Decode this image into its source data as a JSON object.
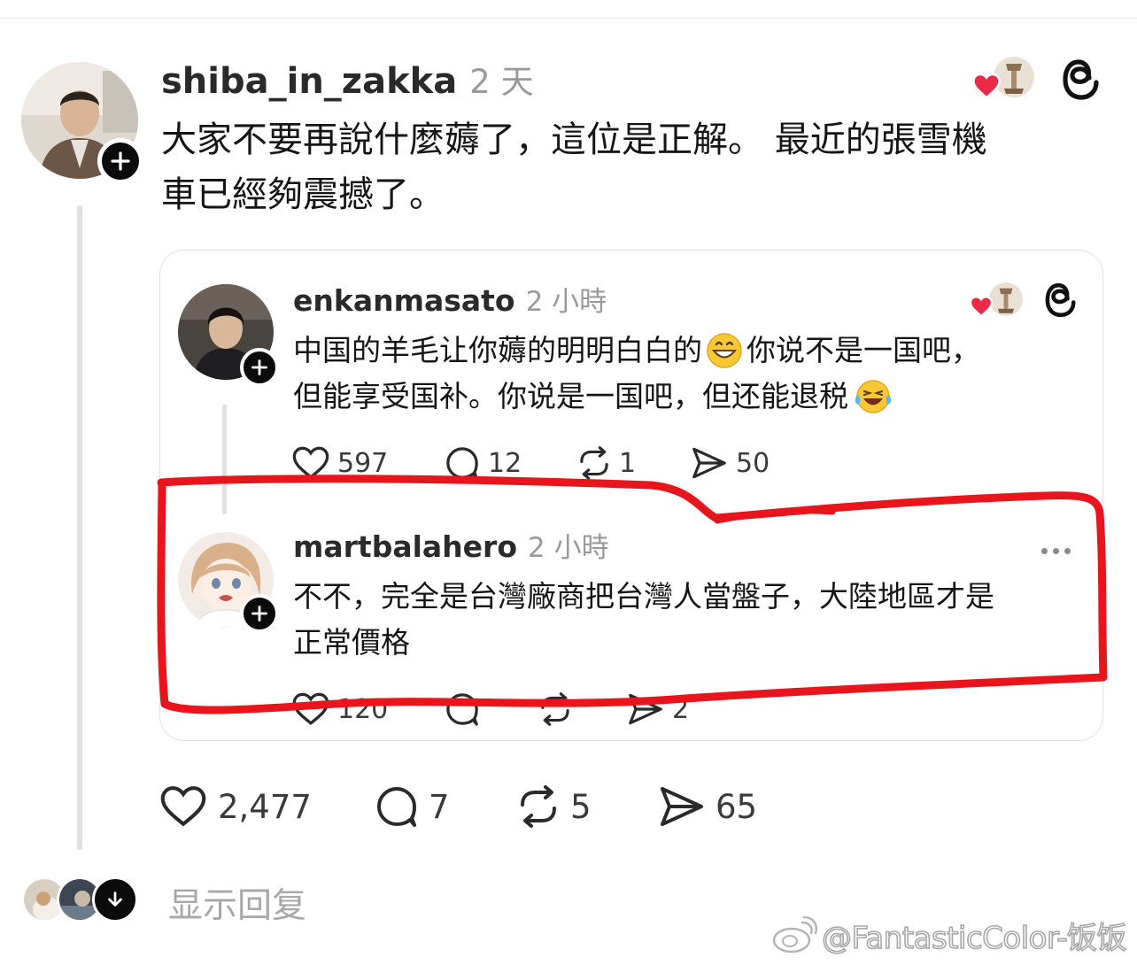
{
  "post": {
    "username": "shiba_in_zakka",
    "time": "2 天",
    "body_line1": "大家不要再說什麼薅了，這位是正解。 最近的張雪機",
    "body_line2": "車已經夠震撼了。",
    "stats": {
      "likes": "2,477",
      "comments": "7",
      "reposts": "5",
      "shares": "65"
    }
  },
  "quoted": {
    "first": {
      "username": "enkanmasato",
      "time": "2 小時",
      "line1_a": "中国的羊毛让你薅的明明白白的",
      "line1_b": "你说不是一国吧，",
      "line2": "但能享受国补。你说是一国吧，但还能退税",
      "stats": {
        "likes": "597",
        "comments": "12",
        "reposts": "1",
        "shares": "50"
      }
    },
    "second": {
      "username": "martbalahero",
      "time": "2 小時",
      "line1": "不不，完全是台灣廠商把台灣人當盤子，大陸地區才是",
      "line2": "正常價格",
      "stats_partial": {
        "likes": "120",
        "shares": "2"
      }
    }
  },
  "footer": {
    "show_replies": "显示回复",
    "watermark": "@FantasticColor-饭饭"
  },
  "colors": {
    "highlight": "#e8161c",
    "heart": "#ea2a46"
  },
  "icons": [
    "plus-icon",
    "heart-icon",
    "comment-icon",
    "repost-icon",
    "share-icon",
    "threads-logo-icon",
    "more-icon",
    "down-arrow-icon",
    "weibo-icon"
  ]
}
